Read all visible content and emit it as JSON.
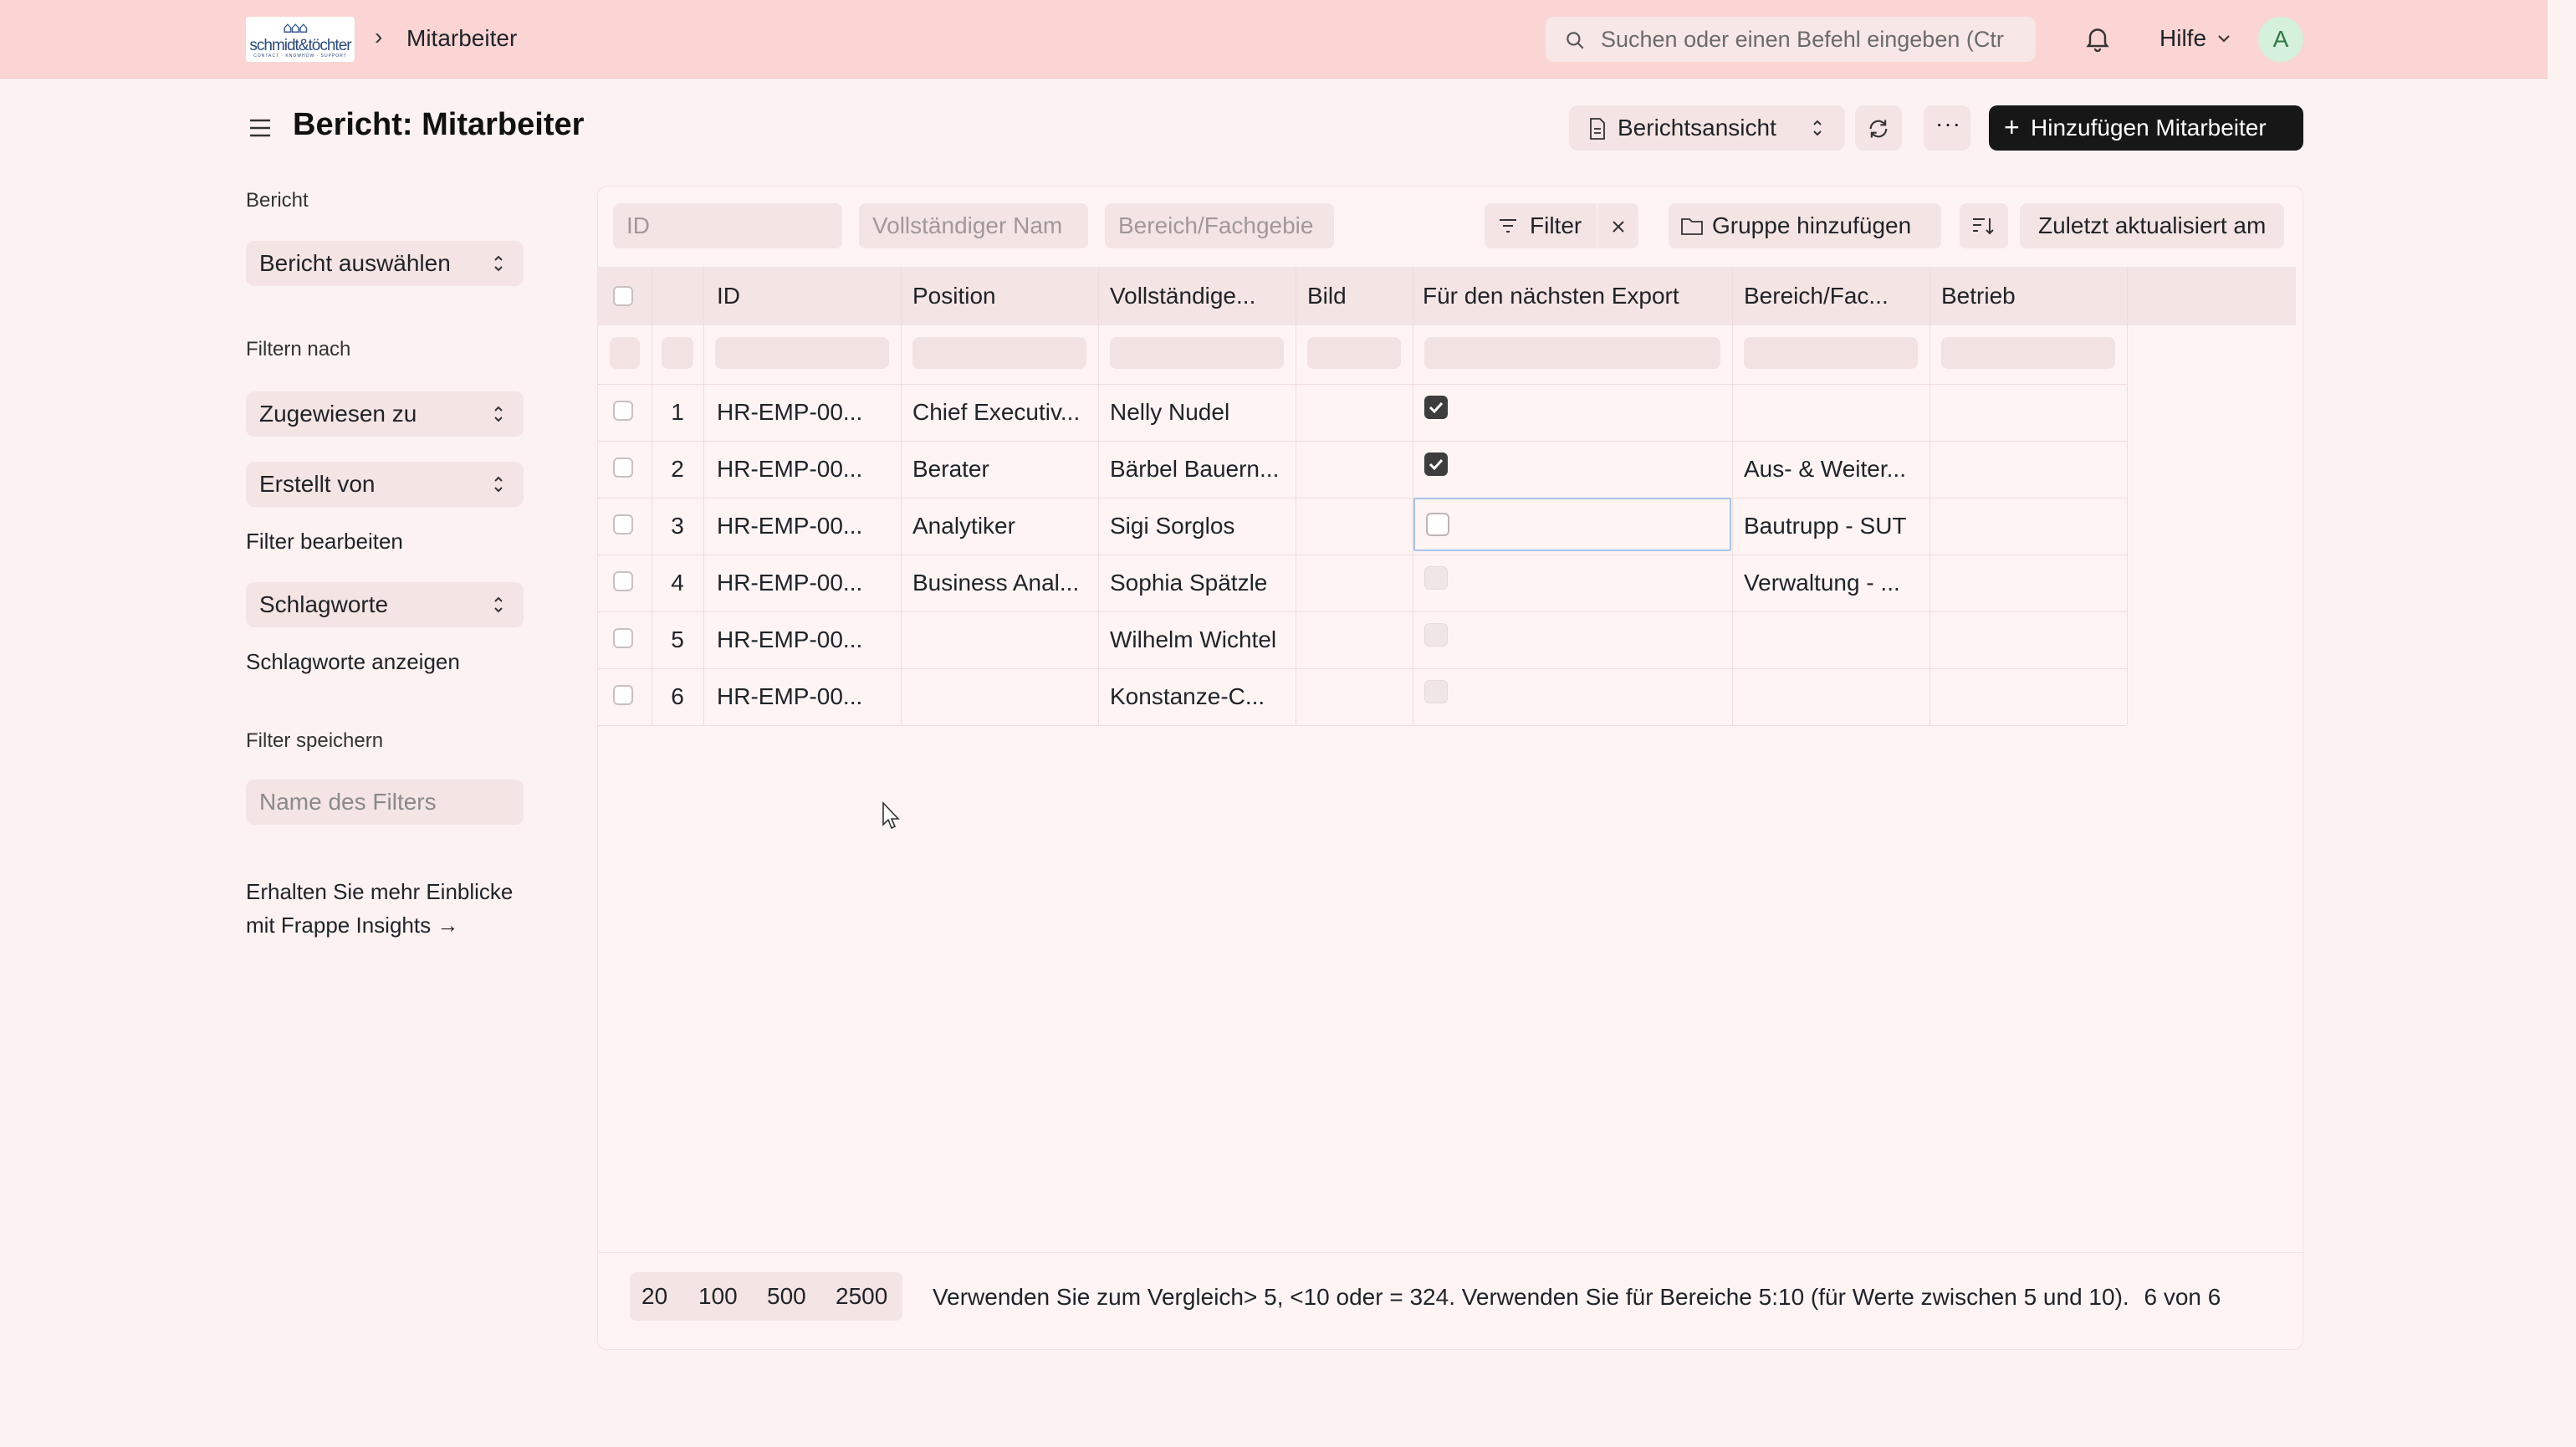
{
  "navbar": {
    "logo_text": "schmidt&töchter",
    "logo_sub": "CONTACT · KNOWHOW · SUPPORT",
    "breadcrumb": "Mitarbeiter",
    "search_placeholder": "Suchen oder einen Befehl eingeben (Ctr",
    "help_label": "Hilfe",
    "avatar_letter": "A"
  },
  "header": {
    "title": "Bericht: Mitarbeiter",
    "view_label": "Berichtsansicht",
    "more_label": "···",
    "add_label": "Hinzufügen Mitarbeiter"
  },
  "sidebar": {
    "report_label": "Bericht",
    "report_select": "Bericht auswählen",
    "filter_by_label": "Filtern nach",
    "assigned_to": "Zugewiesen zu",
    "created_by": "Erstellt von",
    "edit_filters": "Filter bearbeiten",
    "tags": "Schlagworte",
    "show_tags": "Schlagworte anzeigen",
    "save_filter_label": "Filter speichern",
    "filter_name_placeholder": "Name des Filters",
    "insights_text": "Erhalten Sie mehr Einblicke mit Frappe Insights →"
  },
  "filters": {
    "id_placeholder": "ID",
    "name_placeholder": "Vollständiger Nam",
    "area_placeholder": "Bereich/Fachgebie",
    "filter_label": "Filter",
    "group_label": "Gruppe hinzufügen",
    "sort_label": "Zuletzt aktualisiert am"
  },
  "table": {
    "columns": [
      "ID",
      "Position",
      "Vollständige...",
      "Bild",
      "Für den nächsten Export",
      "Bereich/Fac...",
      "Betrieb"
    ],
    "rows": [
      {
        "num": "1",
        "id": "HR-EMP-00...",
        "position": "Chief Executiv...",
        "name": "Nelly Nudel",
        "export": "checked",
        "area": "",
        "betrieb": ""
      },
      {
        "num": "2",
        "id": "HR-EMP-00...",
        "position": "Berater",
        "name": "Bärbel Bauern...",
        "export": "checked",
        "area": "Aus- & Weiter...",
        "betrieb": ""
      },
      {
        "num": "3",
        "id": "HR-EMP-00...",
        "position": "Analytiker",
        "name": "Sigi Sorglos",
        "export": "focused",
        "area": "Bautrupp - SUT",
        "betrieb": ""
      },
      {
        "num": "4",
        "id": "HR-EMP-00...",
        "position": "Business Anal...",
        "name": "Sophia Spätzle",
        "export": "unchecked",
        "area": "Verwaltung - ...",
        "betrieb": ""
      },
      {
        "num": "5",
        "id": "HR-EMP-00...",
        "position": "",
        "name": "Wilhelm Wichtel",
        "export": "unchecked",
        "area": "",
        "betrieb": ""
      },
      {
        "num": "6",
        "id": "HR-EMP-00...",
        "position": "",
        "name": "Konstanze-C...",
        "export": "unchecked",
        "area": "",
        "betrieb": ""
      }
    ]
  },
  "footer": {
    "page_sizes": [
      "20",
      "100",
      "500",
      "2500"
    ],
    "note": "Verwenden Sie zum Vergleich> 5, <10 oder = 324. Verwenden Sie für Bereiche 5:10 (für Werte zwischen 5 und 10).",
    "count": "6 von 6"
  }
}
